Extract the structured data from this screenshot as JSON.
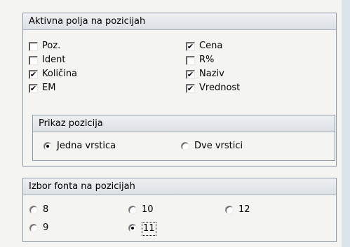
{
  "active_fields": {
    "title": "Aktivna polja na pozicijah",
    "checkboxes": [
      {
        "label": "Poz.",
        "checked": false
      },
      {
        "label": "Ident",
        "checked": false
      },
      {
        "label": "Količina",
        "checked": true
      },
      {
        "label": "EM",
        "checked": true
      },
      {
        "label": "Cena",
        "checked": true
      },
      {
        "label": "R%",
        "checked": false
      },
      {
        "label": "Naziv",
        "checked": true
      },
      {
        "label": "Vrednost",
        "checked": true
      }
    ],
    "display": {
      "title": "Prikaz pozicija",
      "options": [
        {
          "label": "Jedna vrstica",
          "selected": true
        },
        {
          "label": "Dve vrstici",
          "selected": false
        }
      ]
    }
  },
  "font_choice": {
    "title": "Izbor fonta na pozicijah",
    "options": [
      {
        "label": "8",
        "selected": false
      },
      {
        "label": "10",
        "selected": false
      },
      {
        "label": "12",
        "selected": false
      },
      {
        "label": "9",
        "selected": false
      },
      {
        "label": "11",
        "selected": true
      }
    ]
  },
  "check_mark": "✔"
}
